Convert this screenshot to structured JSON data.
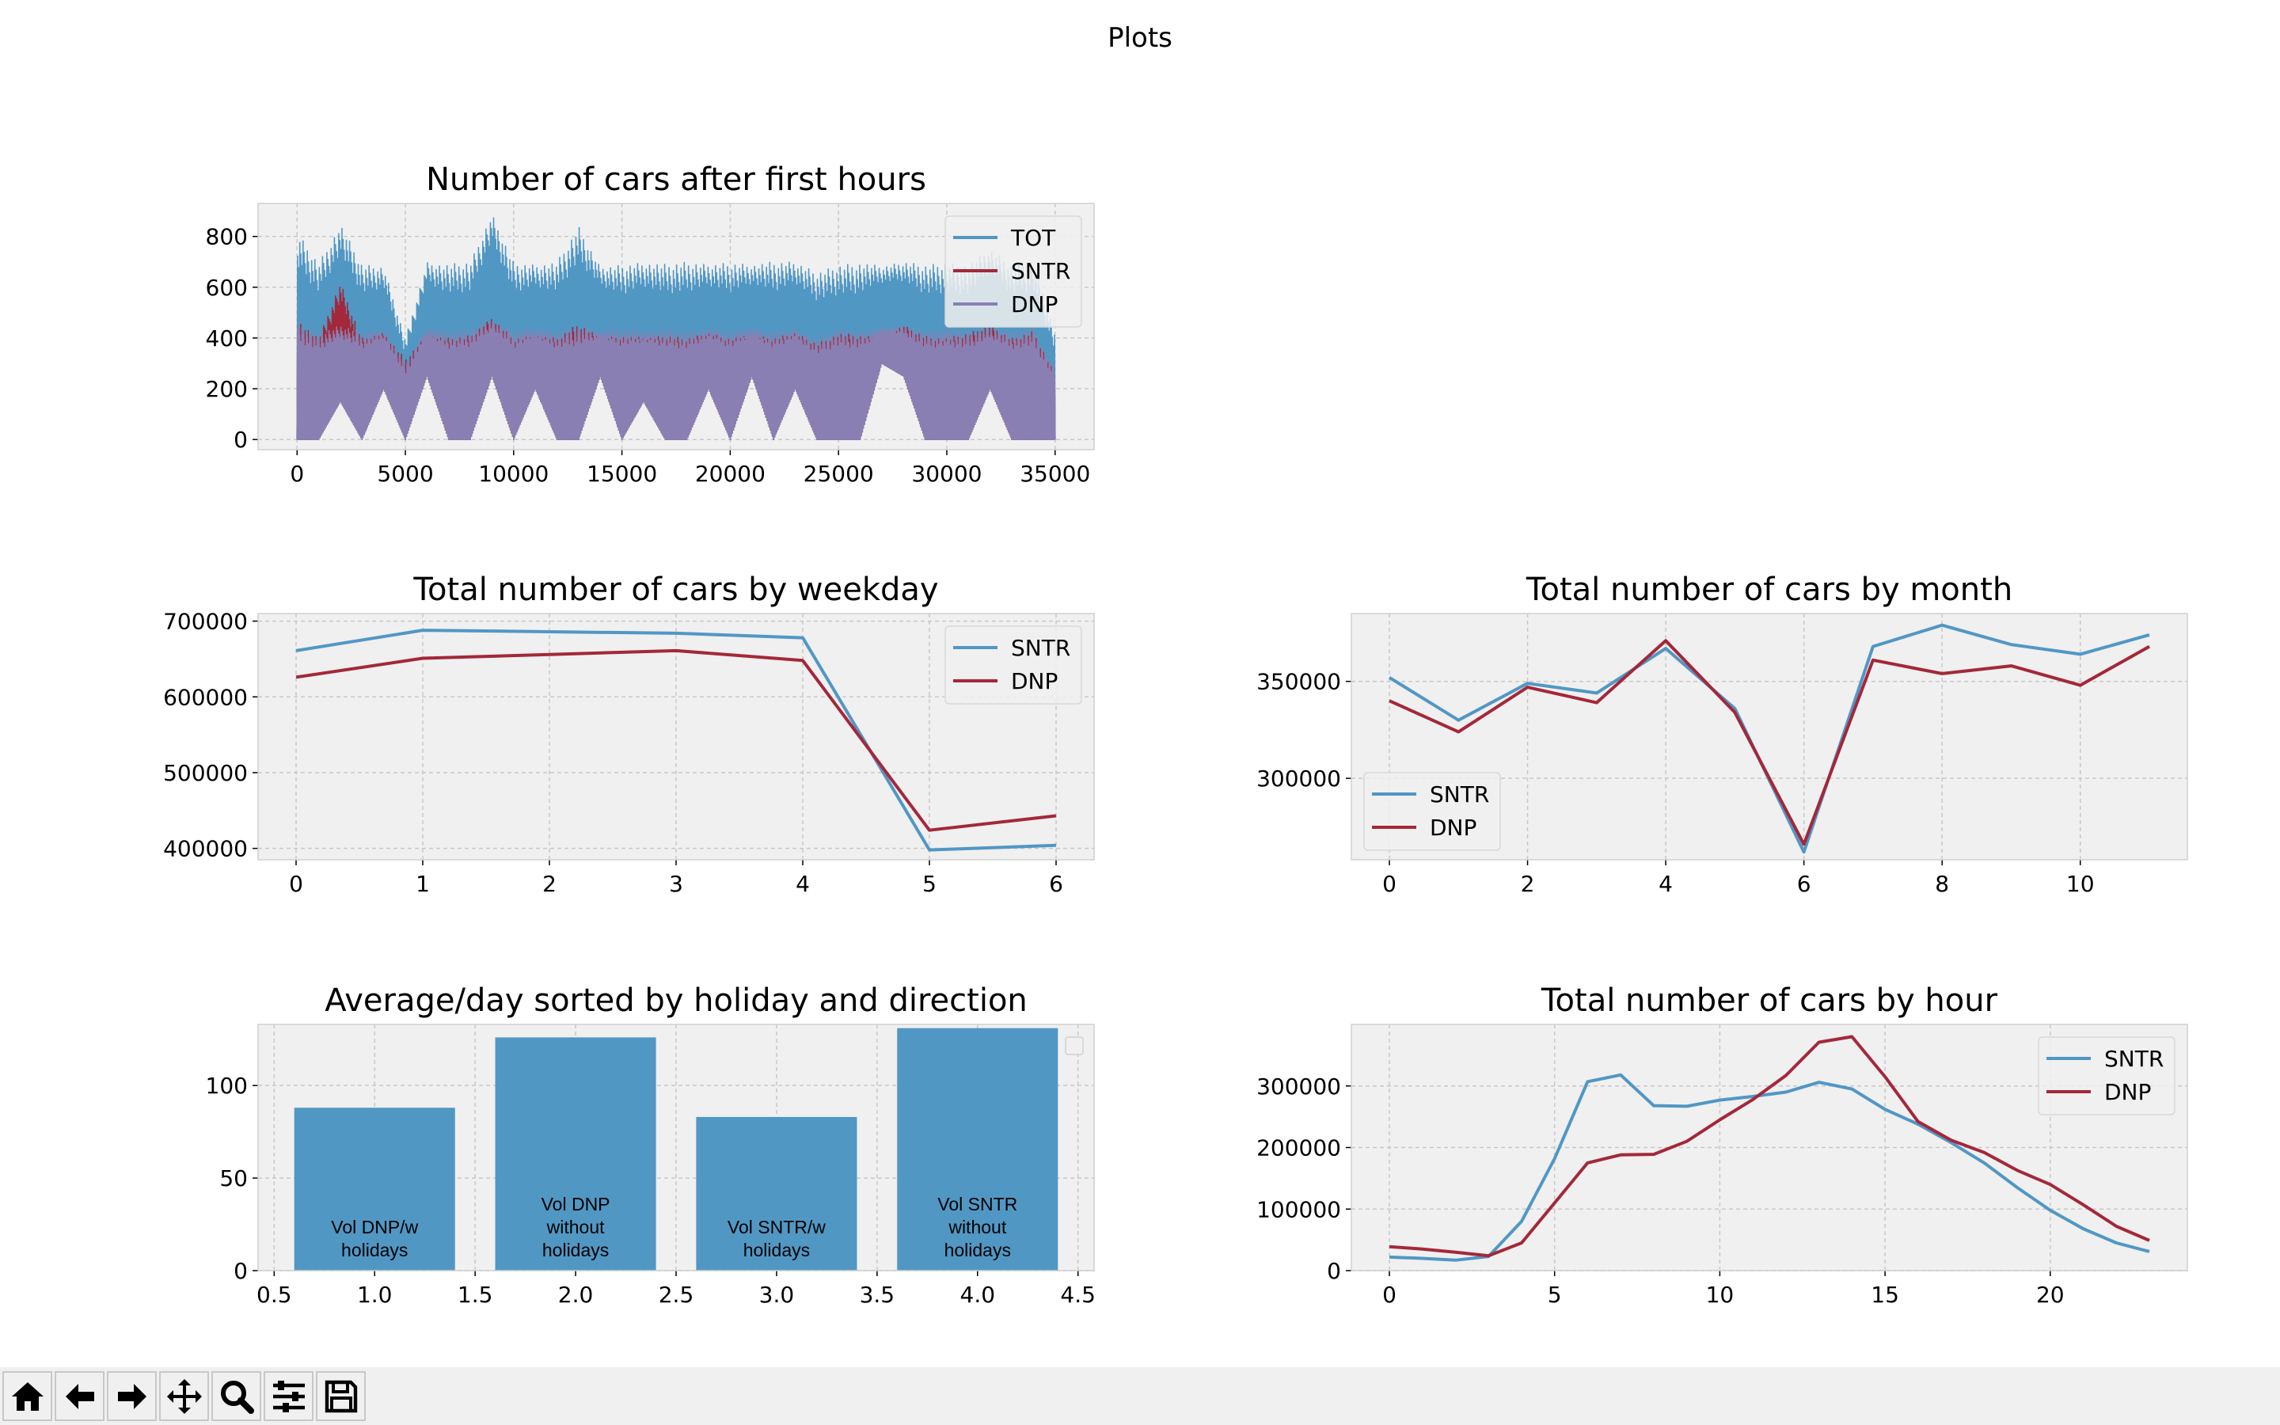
{
  "figure": {
    "suptitle": "Plots"
  },
  "toolbar": {
    "buttons": [
      {
        "name": "home-icon"
      },
      {
        "name": "back-arrow-icon"
      },
      {
        "name": "forward-arrow-icon"
      },
      {
        "name": "pan-move-icon"
      },
      {
        "name": "zoom-magnifier-icon"
      },
      {
        "name": "configure-subplots-icon"
      },
      {
        "name": "save-floppy-icon"
      }
    ]
  },
  "colors": {
    "blue": "#5197c4",
    "red": "#a3283a",
    "purple": "#8a7fb2",
    "axes_bg": "#f0f0f0",
    "grid": "#c8c8c8"
  },
  "chart_data": [
    {
      "id": "after_first_hours",
      "type": "line",
      "title": "Number of cars after first hours",
      "xlim": [
        -1800,
        36800
      ],
      "ylim": [
        -40,
        930
      ],
      "xticks": [
        0,
        5000,
        10000,
        15000,
        20000,
        25000,
        30000,
        35000
      ],
      "yticks": [
        0,
        200,
        400,
        600,
        800
      ],
      "legend_position": "upper right",
      "series": [
        {
          "name": "TOT",
          "color": "#5197c4",
          "band_low": [
            0,
            0,
            150,
            0,
            200,
            0,
            250,
            0,
            0,
            250,
            0,
            200,
            0,
            0,
            250,
            0,
            150,
            0,
            0,
            200,
            0,
            250,
            0,
            200,
            0,
            0,
            0,
            300,
            250,
            0,
            0,
            0,
            200,
            0,
            0,
            0
          ],
          "x": [
            0,
            1000,
            2000,
            3000,
            4000,
            5000,
            6000,
            7000,
            8000,
            9000,
            10000,
            11000,
            12000,
            13000,
            14000,
            15000,
            16000,
            17000,
            18000,
            19000,
            20000,
            21000,
            22000,
            23000,
            24000,
            25000,
            26000,
            27000,
            28000,
            29000,
            30000,
            31000,
            32000,
            33000,
            34000,
            35000
          ],
          "band_high": [
            820,
            700,
            850,
            690,
            680,
            400,
            700,
            690,
            700,
            890,
            700,
            690,
            700,
            840,
            680,
            690,
            700,
            690,
            700,
            690,
            700,
            690,
            700,
            700,
            660,
            690,
            700,
            680,
            700,
            690,
            700,
            690,
            750,
            690,
            710,
            420
          ]
        },
        {
          "name": "SNTR",
          "color": "#a3283a",
          "band_low": [
            0,
            0,
            150,
            0,
            200,
            0,
            250,
            0,
            0,
            250,
            0,
            200,
            0,
            0,
            250,
            0,
            150,
            0,
            0,
            200,
            0,
            250,
            0,
            200,
            0,
            0,
            0,
            300,
            250,
            0,
            0,
            0,
            200,
            0,
            0,
            0
          ],
          "x": [
            0,
            1000,
            2000,
            3000,
            4000,
            5000,
            6000,
            7000,
            8000,
            9000,
            10000,
            11000,
            12000,
            13000,
            14000,
            15000,
            16000,
            17000,
            18000,
            19000,
            20000,
            21000,
            22000,
            23000,
            24000,
            25000,
            26000,
            27000,
            28000,
            29000,
            30000,
            31000,
            32000,
            33000,
            34000,
            35000
          ],
          "band_high": [
            480,
            400,
            620,
            400,
            420,
            320,
            410,
            400,
            410,
            480,
            400,
            410,
            400,
            460,
            400,
            410,
            400,
            410,
            400,
            420,
            400,
            410,
            400,
            420,
            380,
            420,
            410,
            400,
            450,
            410,
            400,
            420,
            450,
            400,
            430,
            260
          ]
        },
        {
          "name": "DNP",
          "color": "#8a7fb2",
          "band_low": [
            0,
            0,
            150,
            0,
            200,
            0,
            250,
            0,
            0,
            250,
            0,
            200,
            0,
            0,
            250,
            0,
            150,
            0,
            0,
            200,
            0,
            250,
            0,
            200,
            0,
            0,
            0,
            300,
            250,
            0,
            0,
            0,
            200,
            0,
            0,
            0
          ],
          "x": [
            0,
            1000,
            2000,
            3000,
            4000,
            5000,
            6000,
            7000,
            8000,
            9000,
            10000,
            11000,
            12000,
            13000,
            14000,
            15000,
            16000,
            17000,
            18000,
            19000,
            20000,
            21000,
            22000,
            23000,
            24000,
            25000,
            26000,
            27000,
            28000,
            29000,
            30000,
            31000,
            32000,
            33000,
            34000,
            35000
          ],
          "band_high": [
            460,
            420,
            450,
            430,
            440,
            300,
            440,
            430,
            440,
            470,
            430,
            440,
            430,
            450,
            430,
            440,
            430,
            440,
            430,
            440,
            430,
            440,
            430,
            440,
            400,
            440,
            430,
            440,
            450,
            430,
            440,
            430,
            440,
            430,
            440,
            280
          ]
        }
      ]
    },
    {
      "id": "by_weekday",
      "type": "line",
      "title": "Total number of cars by weekday",
      "xlim": [
        -0.3,
        6.3
      ],
      "ylim": [
        385000,
        710000
      ],
      "xticks": [
        0,
        1,
        2,
        3,
        4,
        5,
        6
      ],
      "yticks": [
        400000,
        500000,
        600000,
        700000
      ],
      "legend_position": "upper right",
      "x": [
        0,
        1,
        2,
        3,
        4,
        5,
        6
      ],
      "series": [
        {
          "name": "SNTR",
          "color": "#5197c4",
          "values": [
            661000,
            688000,
            686000,
            684000,
            678000,
            398000,
            404000
          ]
        },
        {
          "name": "DNP",
          "color": "#a3283a",
          "values": [
            626000,
            651000,
            656000,
            661000,
            648000,
            424000,
            443000
          ]
        }
      ]
    },
    {
      "id": "by_month",
      "type": "line",
      "title": "Total number of cars by month",
      "xlim": [
        -0.55,
        11.55
      ],
      "ylim": [
        258000,
        385000
      ],
      "xticks": [
        0,
        2,
        4,
        6,
        8,
        10
      ],
      "yticks": [
        300000,
        350000
      ],
      "legend_position": "lower left",
      "x": [
        0,
        1,
        2,
        3,
        4,
        5,
        6,
        7,
        8,
        9,
        10,
        11
      ],
      "series": [
        {
          "name": "SNTR",
          "color": "#5197c4",
          "values": [
            352000,
            330000,
            349000,
            344000,
            367000,
            336000,
            262000,
            368000,
            379000,
            369000,
            364000,
            374000
          ]
        },
        {
          "name": "DNP",
          "color": "#a3283a",
          "values": [
            340000,
            324000,
            347000,
            339000,
            371000,
            334000,
            266000,
            361000,
            354000,
            358000,
            348000,
            368000
          ]
        }
      ]
    },
    {
      "id": "avg_per_day",
      "type": "bar",
      "title": "Average/day sorted by holiday and direction",
      "xlim": [
        0.42,
        4.58
      ],
      "ylim": [
        0,
        133
      ],
      "xticks": [
        0.5,
        1.0,
        1.5,
        2.0,
        2.5,
        3.0,
        3.5,
        4.0,
        4.5
      ],
      "xtick_labels": [
        "0.5",
        "1.0",
        "1.5",
        "2.0",
        "2.5",
        "3.0",
        "3.5",
        "4.0",
        "4.5"
      ],
      "yticks": [
        0,
        50,
        100
      ],
      "bar_width": 0.8,
      "color": "#5197c4",
      "x": [
        1,
        2,
        3,
        4
      ],
      "values": [
        88,
        126,
        83,
        131
      ],
      "bar_labels": [
        [
          "Vol DNP/w",
          "holidays"
        ],
        [
          "Vol DNP",
          "without",
          "holidays"
        ],
        [
          "Vol SNTR/w",
          "holidays"
        ],
        [
          "Vol SNTR",
          "without",
          "holidays"
        ]
      ],
      "legend_position": "upper right"
    },
    {
      "id": "by_hour",
      "type": "line",
      "title": "Total number of cars by hour",
      "xlim": [
        -1.15,
        24.15
      ],
      "ylim": [
        0,
        400000
      ],
      "xticks": [
        0,
        5,
        10,
        15,
        20
      ],
      "yticks": [
        0,
        100000,
        200000,
        300000
      ],
      "legend_position": "upper right",
      "x": [
        0,
        1,
        2,
        3,
        4,
        5,
        6,
        7,
        8,
        9,
        10,
        11,
        12,
        13,
        14,
        15,
        16,
        17,
        18,
        19,
        20,
        21,
        22,
        23
      ],
      "series": [
        {
          "name": "SNTR",
          "color": "#5197c4",
          "values": [
            22000,
            20000,
            17000,
            23000,
            80000,
            182000,
            307000,
            318000,
            268000,
            267000,
            277000,
            283000,
            290000,
            306000,
            295000,
            262000,
            238000,
            208000,
            175000,
            135000,
            98000,
            68000,
            45000,
            31000
          ]
        },
        {
          "name": "DNP",
          "color": "#a3283a",
          "values": [
            39000,
            35000,
            30000,
            24000,
            45000,
            110000,
            175000,
            188000,
            189000,
            210000,
            245000,
            278000,
            317000,
            371000,
            380000,
            315000,
            242000,
            212000,
            192000,
            163000,
            140000,
            107000,
            72000,
            49000
          ]
        }
      ]
    }
  ]
}
